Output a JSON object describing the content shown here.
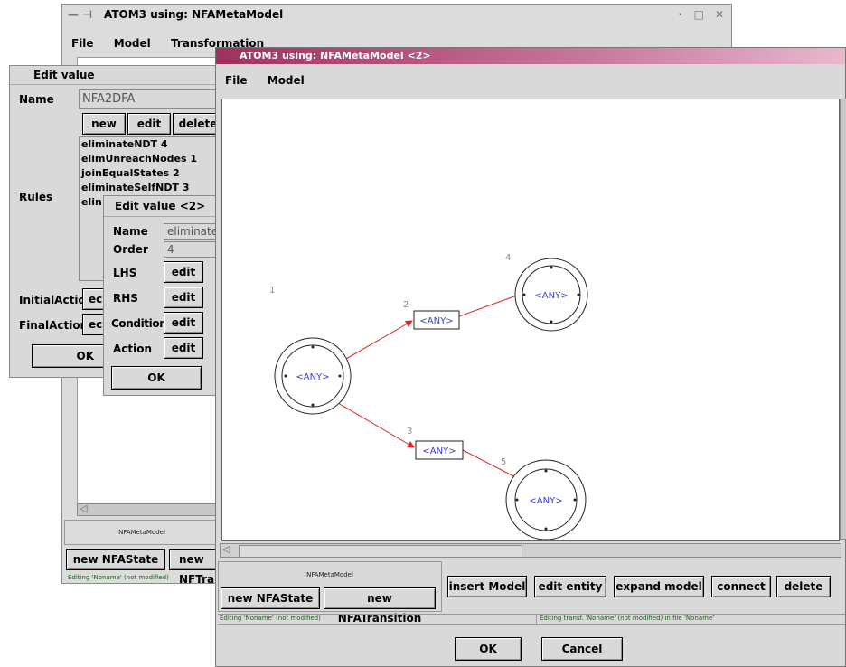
{
  "back_window": {
    "title": "ATOM3 using: NFAMetaModel",
    "menu": [
      "File",
      "Model",
      "Transformation"
    ],
    "model_label": "NFAMetaModel",
    "buttons": [
      "new NFAState",
      "new NFTransition"
    ],
    "status": "Editing 'Noname' (not modified)"
  },
  "edit_value_dialog": {
    "title": "Edit value",
    "name_label": "Name",
    "name_value": "NFA2DFA",
    "btn_new": "new",
    "btn_edit": "edit",
    "btn_delete": "delete",
    "rules_label": "Rules",
    "rules": [
      "eliminateNDT 4",
      "elimUnreachNodes 1",
      "joinEqualStates 2",
      "eliminateSelfNDT 3",
      "elin"
    ],
    "initial_action_label": "InitialAction",
    "initial_action_btn": "ec",
    "final_action_label": "FinalAction",
    "final_action_btn": "ec",
    "ok": "OK"
  },
  "edit_value_2_dialog": {
    "title": "Edit value <2>",
    "name_label": "Name",
    "name_value": "eliminateN",
    "order_label": "Order",
    "order_value": "4",
    "lhs_label": "LHS",
    "rhs_label": "RHS",
    "condition_label": "Condition",
    "action_label": "Action",
    "edit_label": "edit",
    "ok": "OK"
  },
  "front_window": {
    "title": "ATOM3 using: NFAMetaModel <2>",
    "menu": [
      "File",
      "Model"
    ],
    "model_label": "NFAMetaModel",
    "btn_new_state": "new NFAState",
    "btn_new_transition": "new NFATransition",
    "btn_insert_model": "insert Model",
    "btn_edit_entity": "edit entity",
    "btn_expand_model": "expand model",
    "btn_connect": "connect",
    "btn_delete": "delete",
    "status_left": "Editing 'Noname' (not modified)",
    "status_right": "Editing transf. 'Noname' (not modified) in file 'Noname'",
    "ok": "OK",
    "cancel": "Cancel"
  },
  "graph": {
    "states": [
      {
        "id": "1",
        "label": "<ANY>"
      },
      {
        "id": "4",
        "label": "<ANY>"
      },
      {
        "id": "5",
        "label": "<ANY>"
      }
    ],
    "transitions": [
      {
        "id": "2",
        "label": "<ANY>"
      },
      {
        "id": "3",
        "label": "<ANY>"
      }
    ]
  },
  "colors": {
    "front_title_gradient_start": "#a0305c",
    "front_title_gradient_end": "#e8b8cc",
    "edge": "#e02020",
    "node_label": "#3a3ad0",
    "status_text": "#1a5f1a"
  }
}
